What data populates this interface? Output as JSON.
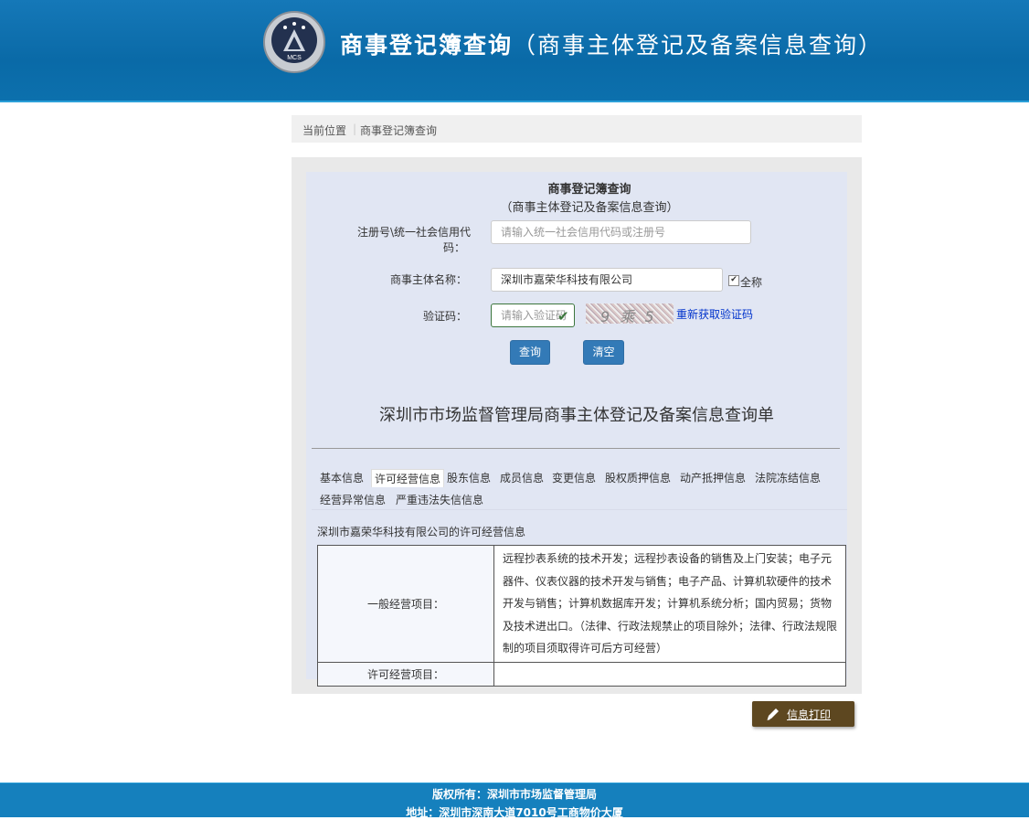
{
  "header": {
    "title_main": "商事登记簿查询",
    "title_sub": "（商事主体登记及备案信息查询）",
    "logo_text": "MCS"
  },
  "breadcrumb": {
    "label": "当前位置",
    "separator": "|",
    "current": "商事登记簿查询"
  },
  "form": {
    "title": "商事登记簿查询",
    "subtitle": "（商事主体登记及备案信息查询）",
    "regno_label_line1": "注册号\\统一社会信用代",
    "regno_label_line2": "码：",
    "regno_placeholder": "请输入统一社会信用代码或注册号",
    "name_label": "商事主体名称：",
    "name_value": "深圳市嘉荣华科技有限公司",
    "fullname_checked": true,
    "fullname_label": "全称",
    "captcha_label": "验证码：",
    "captcha_placeholder": "请输入验证码",
    "captcha_image_text": "9 乘 5 = ?",
    "refresh_link": "重新获取验证码",
    "query_button": "查询",
    "clear_button": "清空"
  },
  "report": {
    "title": "深圳市市场监督管理局商事主体登记及备案信息查询单",
    "tabs": [
      "基本信息",
      "许可经营信息",
      "股东信息",
      "成员信息",
      "变更信息",
      "股权质押信息",
      "动产抵押信息",
      "法院冻结信息",
      "经营异常信息",
      "严重违法失信信息"
    ],
    "active_tab": "许可经营信息",
    "section_heading": "深圳市嘉荣华科技有限公司的许可经营信息",
    "general_label": "一般经营项目：",
    "general_value": "远程抄表系统的技术开发；远程抄表设备的销售及上门安装；电子元器件、仪表仪器的技术开发与销售；电子产品、计算机软硬件的技术开发与销售；计算机数据库开发；计算机系统分析；国内贸易；货物及技术进出口。（法律、行政法规禁止的项目除外；法律、行政法规限制的项目须取得许可后方可经营）",
    "licensed_label": "许可经营项目：",
    "licensed_value": ""
  },
  "print_button": "信息打印",
  "footer": {
    "copyright": "版权所有：深圳市市场监督管理局",
    "address": "地址：深圳市深南大道7010号工商物价大厦"
  },
  "colors": {
    "header_blue": "#0a6aa7",
    "button_blue": "#337ab7",
    "print_brown": "#5d4720",
    "form_bg": "#e1e6f3"
  }
}
